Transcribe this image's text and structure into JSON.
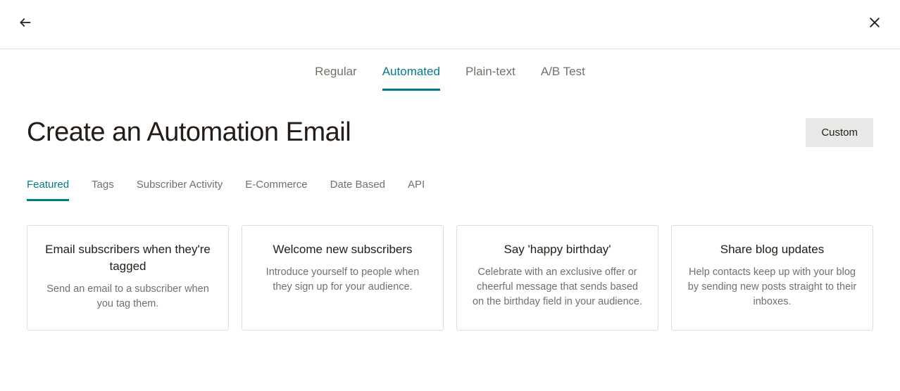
{
  "topbar": {
    "back_icon": "arrow-left",
    "close_icon": "close"
  },
  "primary_tabs": [
    {
      "label": "Regular",
      "active": false
    },
    {
      "label": "Automated",
      "active": true
    },
    {
      "label": "Plain-text",
      "active": false
    },
    {
      "label": "A/B Test",
      "active": false
    }
  ],
  "page_title": "Create an Automation Email",
  "custom_button_label": "Custom",
  "secondary_tabs": [
    {
      "label": "Featured",
      "active": true
    },
    {
      "label": "Tags",
      "active": false
    },
    {
      "label": "Subscriber Activity",
      "active": false
    },
    {
      "label": "E-Commerce",
      "active": false
    },
    {
      "label": "Date Based",
      "active": false
    },
    {
      "label": "API",
      "active": false
    }
  ],
  "cards": [
    {
      "title": "Email subscribers when they're tagged",
      "desc": "Send an email to a subscriber when you tag them."
    },
    {
      "title": "Welcome new subscribers",
      "desc": "Introduce yourself to people when they sign up for your audience."
    },
    {
      "title": "Say 'happy birthday'",
      "desc": "Celebrate with an exclusive offer or cheerful message that sends based on the birthday field in your audience."
    },
    {
      "title": "Share blog updates",
      "desc": "Help contacts keep up with your blog by sending new posts straight to their inboxes."
    }
  ]
}
